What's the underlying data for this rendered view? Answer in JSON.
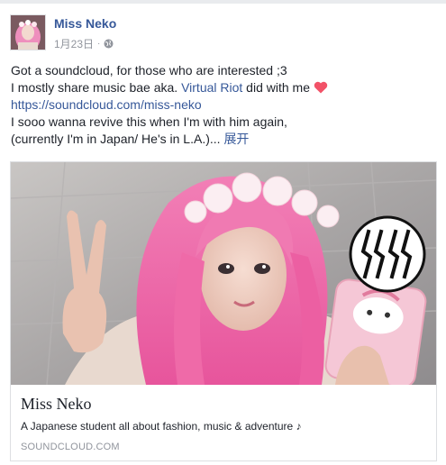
{
  "post": {
    "author": "Miss Neko",
    "date": "1月23日",
    "separator": "·",
    "privacy_icon": "globe-icon",
    "text": {
      "line1": "Got a soundcloud, for those who are interested ;3",
      "line2_prefix": "I mostly share music bae aka. ",
      "line2_link": "Virtual Riot",
      "line2_suffix": " did with me ",
      "line2_emoji": "heart-icon",
      "line3_link": "https://soundcloud.com/miss-neko",
      "line4": "I sooo wanna revive this when I'm with him again,",
      "line5": "(currently I'm in Japan/ He's in L.A.)...",
      "see_more": "展开"
    }
  },
  "link_card": {
    "title": "Miss Neko",
    "description": "A Japanese student all about fashion, music & adventure ♪",
    "domain": "SOUNDCLOUD.COM",
    "logo": "watermark-logo"
  },
  "colors": {
    "link": "#365899",
    "text": "#1d2129",
    "meta": "#90949c",
    "heart": "#f25268",
    "border": "#dddfe2"
  }
}
